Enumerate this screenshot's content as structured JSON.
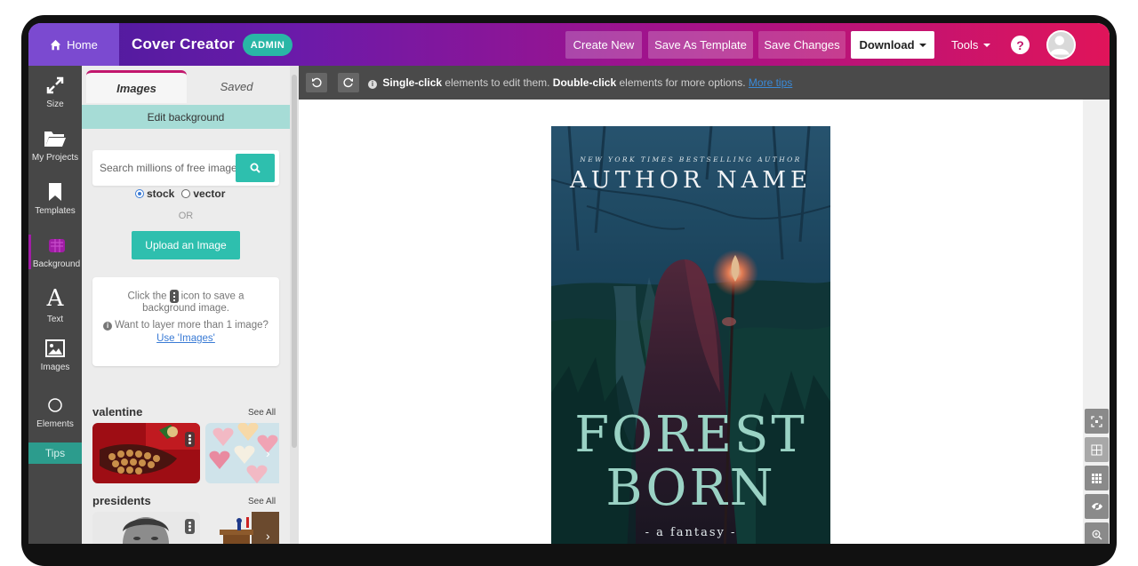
{
  "topbar": {
    "home_label": "Home",
    "brand": "Cover Creator",
    "badge": "ADMIN",
    "buttons": {
      "create_new": "Create New",
      "save_as_template": "Save As Template",
      "save_changes": "Save Changes",
      "download": "Download",
      "tools": "Tools",
      "help": "?"
    },
    "colors": {
      "gradient_start": "#4a1c9c",
      "gradient_end": "#e0145a",
      "home_bg": "#7b4ad0",
      "badge_bg": "#29b6a6"
    }
  },
  "rail": {
    "items": [
      {
        "label": "Size",
        "icon": "expand-icon"
      },
      {
        "label": "My Projects",
        "icon": "folder-icon"
      },
      {
        "label": "Templates",
        "icon": "bookmark-icon"
      },
      {
        "label": "Background",
        "icon": "background-icon",
        "active": true
      },
      {
        "label": "Text",
        "icon": "text-icon"
      },
      {
        "label": "Images",
        "icon": "image-icon"
      },
      {
        "label": "Elements",
        "icon": "circle-icon"
      }
    ],
    "tips": "Tips"
  },
  "panel": {
    "tabs": {
      "images": "Images",
      "saved": "Saved"
    },
    "edit_background": "Edit background",
    "search_placeholder": "Search millions of free images",
    "radio_stock": "stock",
    "radio_vector": "vector",
    "or": "OR",
    "upload": "Upload an Image",
    "info": {
      "line1_before": "Click the",
      "line1_after": "icon to save a background image.",
      "line2": "Want to layer more than 1 image?",
      "link": "Use 'Images'"
    },
    "categories": [
      {
        "title": "valentine",
        "see_all": "See All"
      },
      {
        "title": "presidents",
        "see_all": "See All"
      }
    ]
  },
  "canvas_toolbar": {
    "hint_single": "Single-click",
    "hint_single_rest": "elements to edit them.",
    "hint_double": "Double-click",
    "hint_double_rest": "elements for more options.",
    "more_tips": "More tips"
  },
  "cover": {
    "tagline": "NEW YORK TIMES BESTSELLING AUTHOR",
    "author": "AUTHOR NAME",
    "title_line1": "FOREST",
    "title_line2": "BORN",
    "subtitle": "- a fantasy -"
  },
  "accents": {
    "teal": "#2ebfae",
    "link": "#3a7bd5",
    "active_rail": "#a11da6"
  }
}
